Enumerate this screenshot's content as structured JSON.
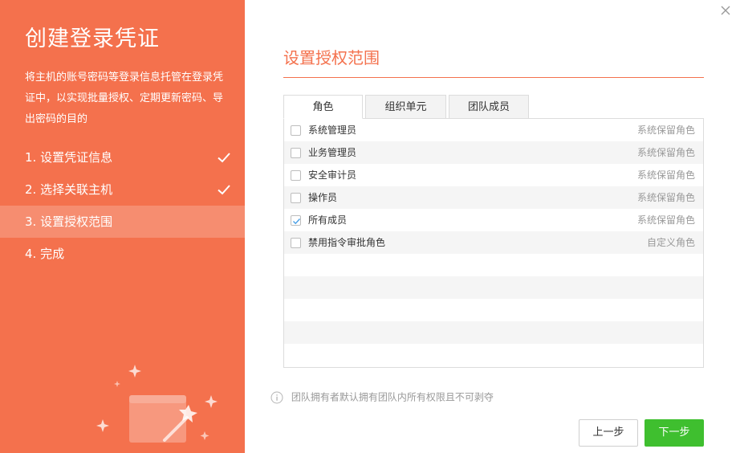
{
  "left": {
    "title": "创建登录凭证",
    "description": "将主机的账号密码等登录信息托管在登录凭证中，以实现批量授权、定期更新密码、导出密码的目的",
    "steps": [
      {
        "label": "1. 设置凭证信息",
        "done": true
      },
      {
        "label": "2. 选择关联主机",
        "done": true
      },
      {
        "label": "3. 设置授权范围",
        "active": true
      },
      {
        "label": "4. 完成"
      }
    ]
  },
  "right": {
    "title": "设置授权范围",
    "tabs": [
      {
        "label": "角色",
        "active": true
      },
      {
        "label": "组织单元"
      },
      {
        "label": "团队成员"
      }
    ],
    "rows": [
      {
        "name": "系统管理员",
        "type": "系统保留角色",
        "checked": false
      },
      {
        "name": "业务管理员",
        "type": "系统保留角色",
        "checked": false
      },
      {
        "name": "安全审计员",
        "type": "系统保留角色",
        "checked": false
      },
      {
        "name": "操作员",
        "type": "系统保留角色",
        "checked": false
      },
      {
        "name": "所有成员",
        "type": "系统保留角色",
        "checked": true
      },
      {
        "name": "禁用指令审批角色",
        "type": "自定义角色",
        "checked": false
      }
    ],
    "notice": "团队拥有者默认拥有团队内所有权限且不可剥夺",
    "buttons": {
      "prev": "上一步",
      "next": "下一步"
    }
  },
  "colors": {
    "accent": "#f4714d",
    "primary_button": "#3fbf2f"
  },
  "icons": {
    "close": "close-icon",
    "check": "check-icon",
    "info": "info-icon",
    "illustration": "magic-wand-illustration"
  }
}
